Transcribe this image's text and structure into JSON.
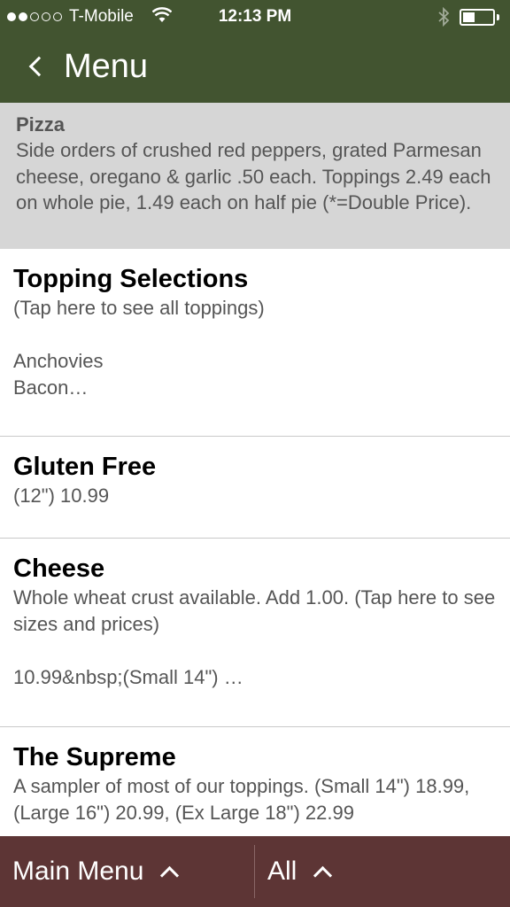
{
  "status_bar": {
    "carrier": "T-Mobile",
    "time": "12:13 PM",
    "signal_bars": 2,
    "signal_total": 5,
    "battery_level": 0.4
  },
  "nav": {
    "back_label": "Menu"
  },
  "section": {
    "title": "Pizza",
    "description": "Side orders of crushed red peppers, grated Parmesan cheese, oregano & garlic .50 each. Toppings 2.49 each on whole pie, 1.49 each on half pie (*=Double Price)."
  },
  "items": [
    {
      "title": "Topping Selections",
      "description": "(Tap here to see all toppings)",
      "extra_lines": [
        "Anchovies",
        "Bacon…"
      ]
    },
    {
      "title": "Gluten Free",
      "description": "(12\") 10.99"
    },
    {
      "title": "Cheese",
      "description": "Whole wheat crust available. Add 1.00. (Tap here to see sizes and prices)",
      "extra_lines": [
        "10.99&nbsp;(Small 14\") …"
      ]
    },
    {
      "title": "The Supreme",
      "description": "A sampler of most of our toppings. (Small 14\") 18.99, (Large 16\") 20.99, (Ex Large 18\") 22.99"
    }
  ],
  "bottom_bar": {
    "main_menu_label": "Main Menu",
    "all_label": "All"
  },
  "colors": {
    "header": "#425430",
    "section_bg": "#d6d6d6",
    "bottom_bar": "#5d3535"
  },
  "icons": {
    "back": "chevron-left-icon",
    "wifi": "wifi-icon",
    "bluetooth": "bluetooth-icon",
    "battery": "battery-icon",
    "main_menu": "chevron-up-icon",
    "all": "chevron-up-icon"
  }
}
